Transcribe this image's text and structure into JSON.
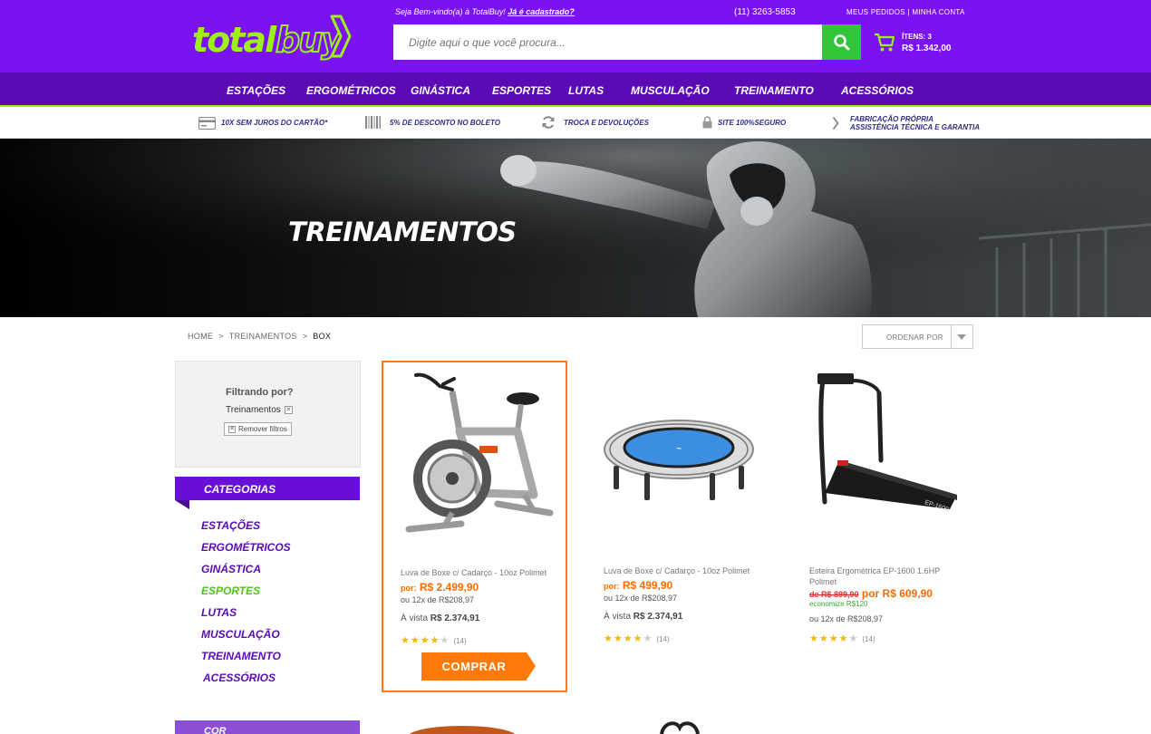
{
  "header": {
    "logo_text": "totalbuy",
    "welcome": "Seja Bem-vindo(a) à TotalBuy!",
    "welcome_link": "Já é cadastrado?",
    "phone": "(11) 3263-5853",
    "account_links": "MEUS PEDIDOS | MINHA CONTA",
    "search_placeholder": "Digite aqui o que você procura...",
    "cart_items": "ÍTENS: 3",
    "cart_total": "R$ 1.342,00"
  },
  "nav": {
    "items": [
      "ESTAÇÕES",
      "ERGOMÉTRICOS",
      "GINÁSTICA",
      "ESPORTES",
      "LUTAS",
      "MUSCULAÇÃO",
      "TREINAMENTO",
      "ACESSÓRIOS"
    ]
  },
  "benefits": {
    "items": [
      "10X SEM JUROS DO CARTÃO*",
      "5% DE DESCONTO NO BOLETO",
      "TROCA E DEVOLUÇÕES",
      "SITE 100%SEGURO",
      "FABRICAÇÃO PRÓPRIA",
      "ASSISTÊNCIA TÉCNICA E GARANTIA"
    ]
  },
  "banner": {
    "title": "TREINAMENTOS"
  },
  "breadcrumb": {
    "items": [
      "HOME",
      "TREINAMENTOS",
      "BOX"
    ],
    "separator": ">"
  },
  "sort": {
    "label": "ORDENAR POR"
  },
  "filter": {
    "title": "Filtrando por?",
    "tag": "Treinamentos",
    "remove_label": "Remover filtros",
    "close_glyph": "✕"
  },
  "categories": {
    "title": "CATEGORIAS",
    "items": [
      "ESTAÇÕES",
      "ERGOMÉTRICOS",
      "GINÁSTICA",
      "ESPORTES",
      "LUTAS",
      "MUSCULAÇÃO",
      "TREINAMENTO",
      "ACESSÓRIOS"
    ],
    "active": "ESPORTES",
    "next_section": "COR"
  },
  "products": [
    {
      "name": "Luva de Boxe c/ Cadarço - 10oz Polimet",
      "por": "por:",
      "price": "R$ 2.499,90",
      "installments": "ou 12x de R$208,97",
      "vista_label": "À vista",
      "vista_price": "R$ 2.374,91",
      "rating": 4,
      "reviews": "(14)",
      "button": "COMPRAR"
    },
    {
      "name": "Luva de Boxe c/ Cadarço - 10oz Polimet",
      "por": "por:",
      "price": "R$ 499,90",
      "installments": "ou 12x de R$208,97",
      "vista_label": "À vista",
      "vista_price": "R$ 2.374,91",
      "rating": 4,
      "reviews": "(14)"
    },
    {
      "name": "Esteira Ergométrica EP-1600 1.6HP Polimet",
      "old_price": "de R$ 899,90",
      "price": "por R$ 609,90",
      "economy": "economize R$120",
      "installments": "ou 12x de R$208,97",
      "rating": 4,
      "reviews": "(14)"
    }
  ],
  "colors": {
    "brand_purple": "#7a12f2",
    "nav_purple": "#5a0bb5",
    "brand_green": "#9ef01a",
    "search_green": "#33c43a",
    "price_orange": "#ff6a00",
    "buy_orange": "#ff7a0a"
  },
  "icons": [
    "search-icon",
    "cart-icon",
    "credit-card-icon",
    "barcode-icon",
    "refresh-icon",
    "lock-icon",
    "chevron-right-icon",
    "star-icon",
    "caret-down-icon"
  ]
}
